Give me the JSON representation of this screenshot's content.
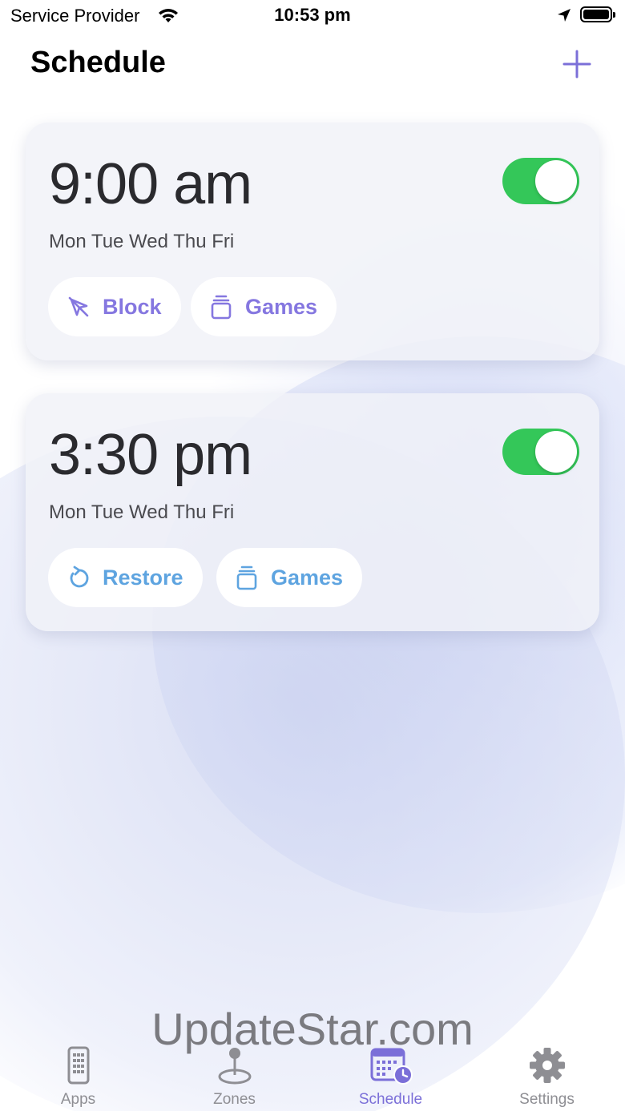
{
  "status_bar": {
    "carrier": "Service Provider",
    "time": "10:53 pm"
  },
  "header": {
    "title": "Schedule",
    "add_icon": "plus-icon"
  },
  "schedules": [
    {
      "time": "9:00 am",
      "days": "Mon Tue Wed Thu Fri",
      "enabled": true,
      "action": {
        "label": "Block",
        "icon": "block-icon",
        "color": "#8577e0"
      },
      "category": {
        "label": "Games",
        "icon": "category-icon",
        "color": "#8577e0"
      }
    },
    {
      "time": "3:30 pm",
      "days": "Mon Tue Wed Thu Fri",
      "enabled": true,
      "action": {
        "label": "Restore",
        "icon": "restore-icon",
        "color": "#5ea4e0"
      },
      "category": {
        "label": "Games",
        "icon": "category-icon",
        "color": "#5ea4e0"
      }
    }
  ],
  "watermark": "UpdateStar.com",
  "tabs": [
    {
      "label": "Apps",
      "icon": "phone-icon",
      "active": false
    },
    {
      "label": "Zones",
      "icon": "map-pin-icon",
      "active": false
    },
    {
      "label": "Schedule",
      "icon": "calendar-clock-icon",
      "active": true
    },
    {
      "label": "Settings",
      "icon": "gear-icon",
      "active": false
    }
  ],
  "colors": {
    "accent": "#7b6fd8",
    "toggle_on": "#34c759",
    "tab_inactive": "#8e8e93"
  }
}
